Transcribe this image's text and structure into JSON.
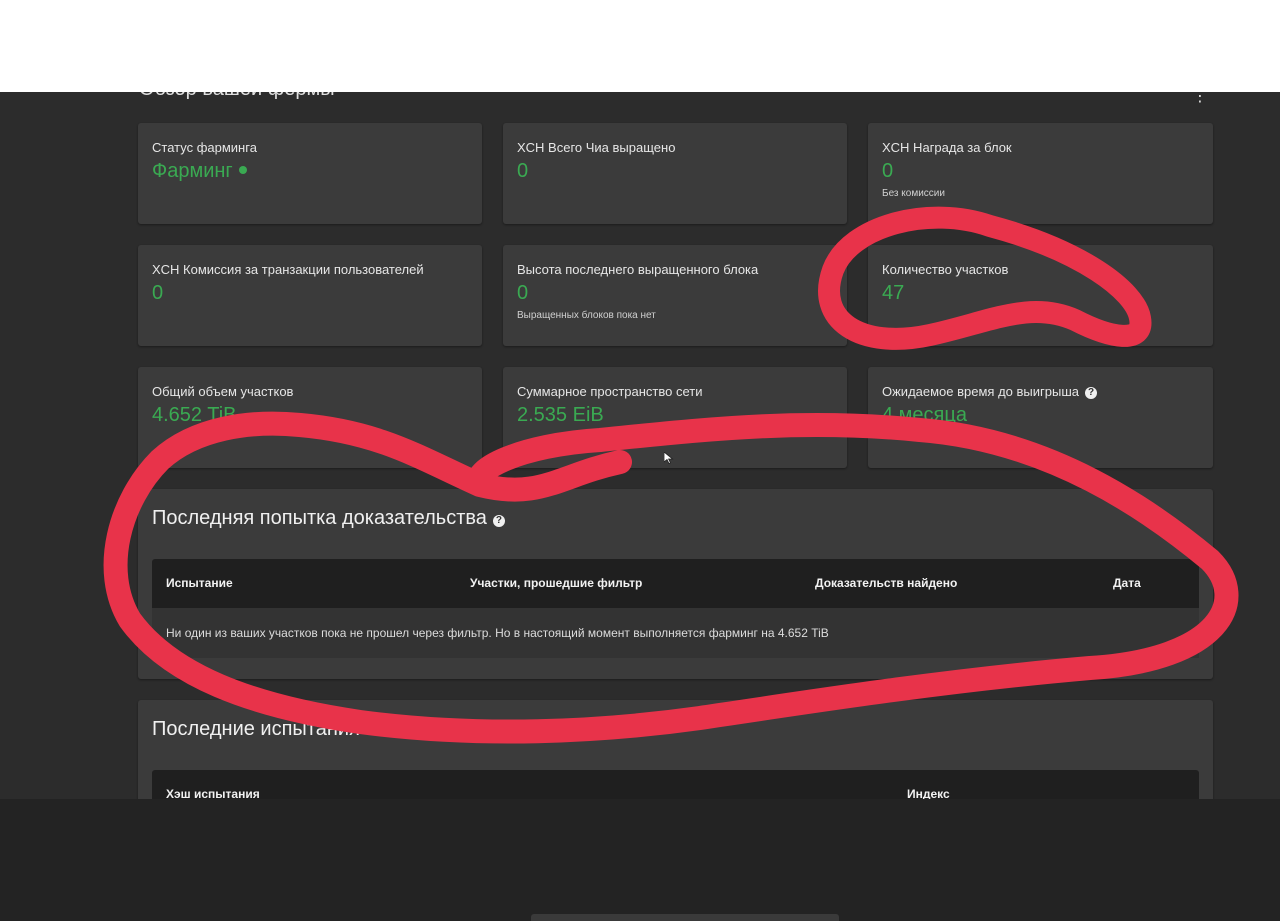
{
  "header": {
    "section_title": "Обзор вашей фермы",
    "more": "⋮"
  },
  "cards": [
    {
      "label": "Статус фарминга",
      "value": "Фарминг",
      "dot": true,
      "sub": ""
    },
    {
      "label": "XCH Всего Чиа выращено",
      "value": "0",
      "sub": ""
    },
    {
      "label": "XCH Награда за блок",
      "value": "0",
      "sub": "Без комиссии"
    },
    {
      "label": "XCH Комиссия за транзакции пользователей",
      "value": "0",
      "sub": ""
    },
    {
      "label": "Высота последнего выращенного блока",
      "value": "0",
      "sub": "Выращенных блоков пока нет"
    },
    {
      "label": "Количество участков",
      "value": "47",
      "sub": ""
    },
    {
      "label": "Общий объем участков",
      "value": "4.652 TiB",
      "sub": ""
    },
    {
      "label": "Суммарное пространство сети",
      "value": "2.535 EiB",
      "sub": ""
    },
    {
      "label": "Ожидаемое время до выигрыша",
      "value": "4 месяца",
      "help": true,
      "sub": ""
    }
  ],
  "proofs": {
    "title": "Последняя попытка доказательства",
    "columns": [
      "Испытание",
      "Участки, прошедшие фильтр",
      "Доказательств найдено",
      "Дата"
    ],
    "message": "Ни один из ваших участков пока не прошел через фильтр. Но в настоящий момент выполняется фарминг на 4.652 TiB"
  },
  "challenges": {
    "title": "Последние испытания",
    "columns": [
      "Хэш испытания",
      "Индекс"
    ]
  },
  "colors": {
    "accent_green": "#3aaa52",
    "card_bg": "#3b3b3b",
    "page_bg": "#2c2c2c",
    "scribble_red": "#e8334a"
  }
}
